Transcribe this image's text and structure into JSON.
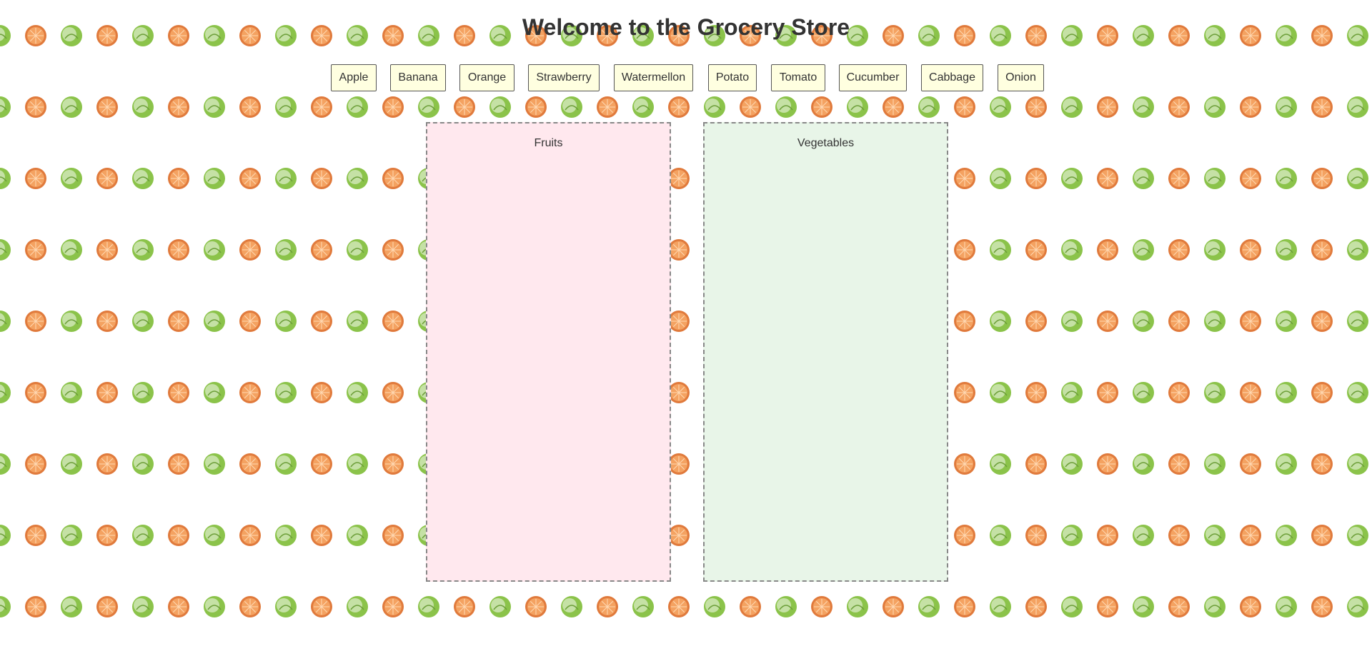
{
  "page": {
    "title": "Welcome to the Grocery Store"
  },
  "items": [
    {
      "label": "Apple"
    },
    {
      "label": "Banana"
    },
    {
      "label": "Orange"
    },
    {
      "label": "Strawberry"
    },
    {
      "label": "Watermellon"
    },
    {
      "label": "Potato"
    },
    {
      "label": "Tomato"
    },
    {
      "label": "Cucumber"
    },
    {
      "label": "Cabbage"
    },
    {
      "label": "Onion"
    }
  ],
  "zones": {
    "fruits": {
      "label": "Fruits",
      "color": "#ffe8ee"
    },
    "vegetables": {
      "label": "Vegetables",
      "color": "#e8f5e8"
    }
  },
  "background": {
    "pattern": [
      "cabbage-icon",
      "orange-slice-icon"
    ],
    "colors": {
      "orange": "#f4a261",
      "orange_ring": "#e07a3c",
      "cabbage": "#8bc34a",
      "cabbage_light": "#c5e1a5"
    }
  }
}
